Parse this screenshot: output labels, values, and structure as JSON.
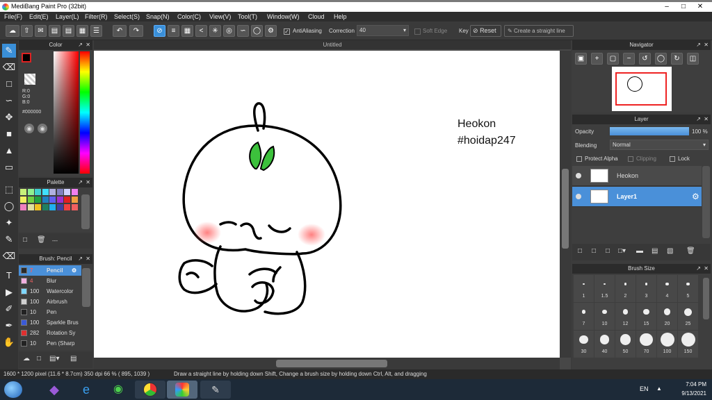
{
  "window": {
    "title": "MediBang Paint Pro (32bit)"
  },
  "menu": [
    "File(F)",
    "Edit(E)",
    "Layer(L)",
    "Filter(R)",
    "Select(S)",
    "Snap(N)",
    "Color(C)",
    "View(V)",
    "Tool(T)",
    "Window(W)",
    "Cloud",
    "Help"
  ],
  "toolbar": {
    "antialiasing_label": "AntiAliasing",
    "correction_label": "Correction",
    "correction_value": "40",
    "soft_edge_label": "Soft Edge",
    "key_label": "Key",
    "reset_label": "Reset",
    "straight_line_label": "Create a straight line"
  },
  "color_panel": {
    "title": "Color",
    "r": "R:0",
    "g": "G:0",
    "b": "B:0",
    "hex": "#000000"
  },
  "palette_panel": {
    "title": "Palette",
    "dash": "---"
  },
  "brush_panel": {
    "title": "Brush: Pencil",
    "items": [
      {
        "size": "7",
        "name": "Pencil",
        "color": "#2a2a2a"
      },
      {
        "size": "4",
        "name": "Blur",
        "color": "#f0b0e0"
      },
      {
        "size": "100",
        "name": "Watercolor",
        "color": "#7fd7ff"
      },
      {
        "size": "100",
        "name": "Airbrush",
        "color": "#d0d0d0"
      },
      {
        "size": "10",
        "name": "Pen",
        "color": "#222222"
      },
      {
        "size": "100",
        "name": "Sparkle Brus",
        "color": "#3a5ad8"
      },
      {
        "size": "282",
        "name": "Rotation Sy",
        "color": "#e03030"
      },
      {
        "size": "10",
        "name": "Pen (Sharp",
        "color": "#222222"
      }
    ]
  },
  "document": {
    "tab": "Untitled",
    "text_line1": "Heokon",
    "text_line2": "#hoidap247"
  },
  "navigator": {
    "title": "Navigator"
  },
  "layer_panel": {
    "title": "Layer",
    "opacity_label": "Opacity",
    "opacity_value": "100 %",
    "opacity": 1.0,
    "blending_label": "Blending",
    "blending_value": "Normal",
    "protect_alpha": "Protect Alpha",
    "clipping": "Clipping",
    "lock": "Lock",
    "layers": [
      {
        "name": "Heokon",
        "selected": false
      },
      {
        "name": "Layer1",
        "selected": true
      }
    ]
  },
  "brush_size": {
    "title": "Brush Size",
    "sizes": [
      "1",
      "1.5",
      "2",
      "3",
      "4",
      "5",
      "7",
      "10",
      "12",
      "15",
      "20",
      "25",
      "30",
      "40",
      "50",
      "70",
      "100",
      "150"
    ]
  },
  "status": {
    "size": "1600 * 1200 pixel  (11.6 * 8.7cm)  350 dpi  66 %  ( 895, 1039 )",
    "hint": "Draw a straight line by holding down Shift, Change a brush size by holding down Ctrl, Alt, and dragging"
  },
  "taskbar": {
    "lang": "EN",
    "time": "7:04 PM",
    "date": "9/13/2021"
  },
  "colors": {
    "accent": "#3a8fd8",
    "layer_selected": "#4a90d9"
  }
}
